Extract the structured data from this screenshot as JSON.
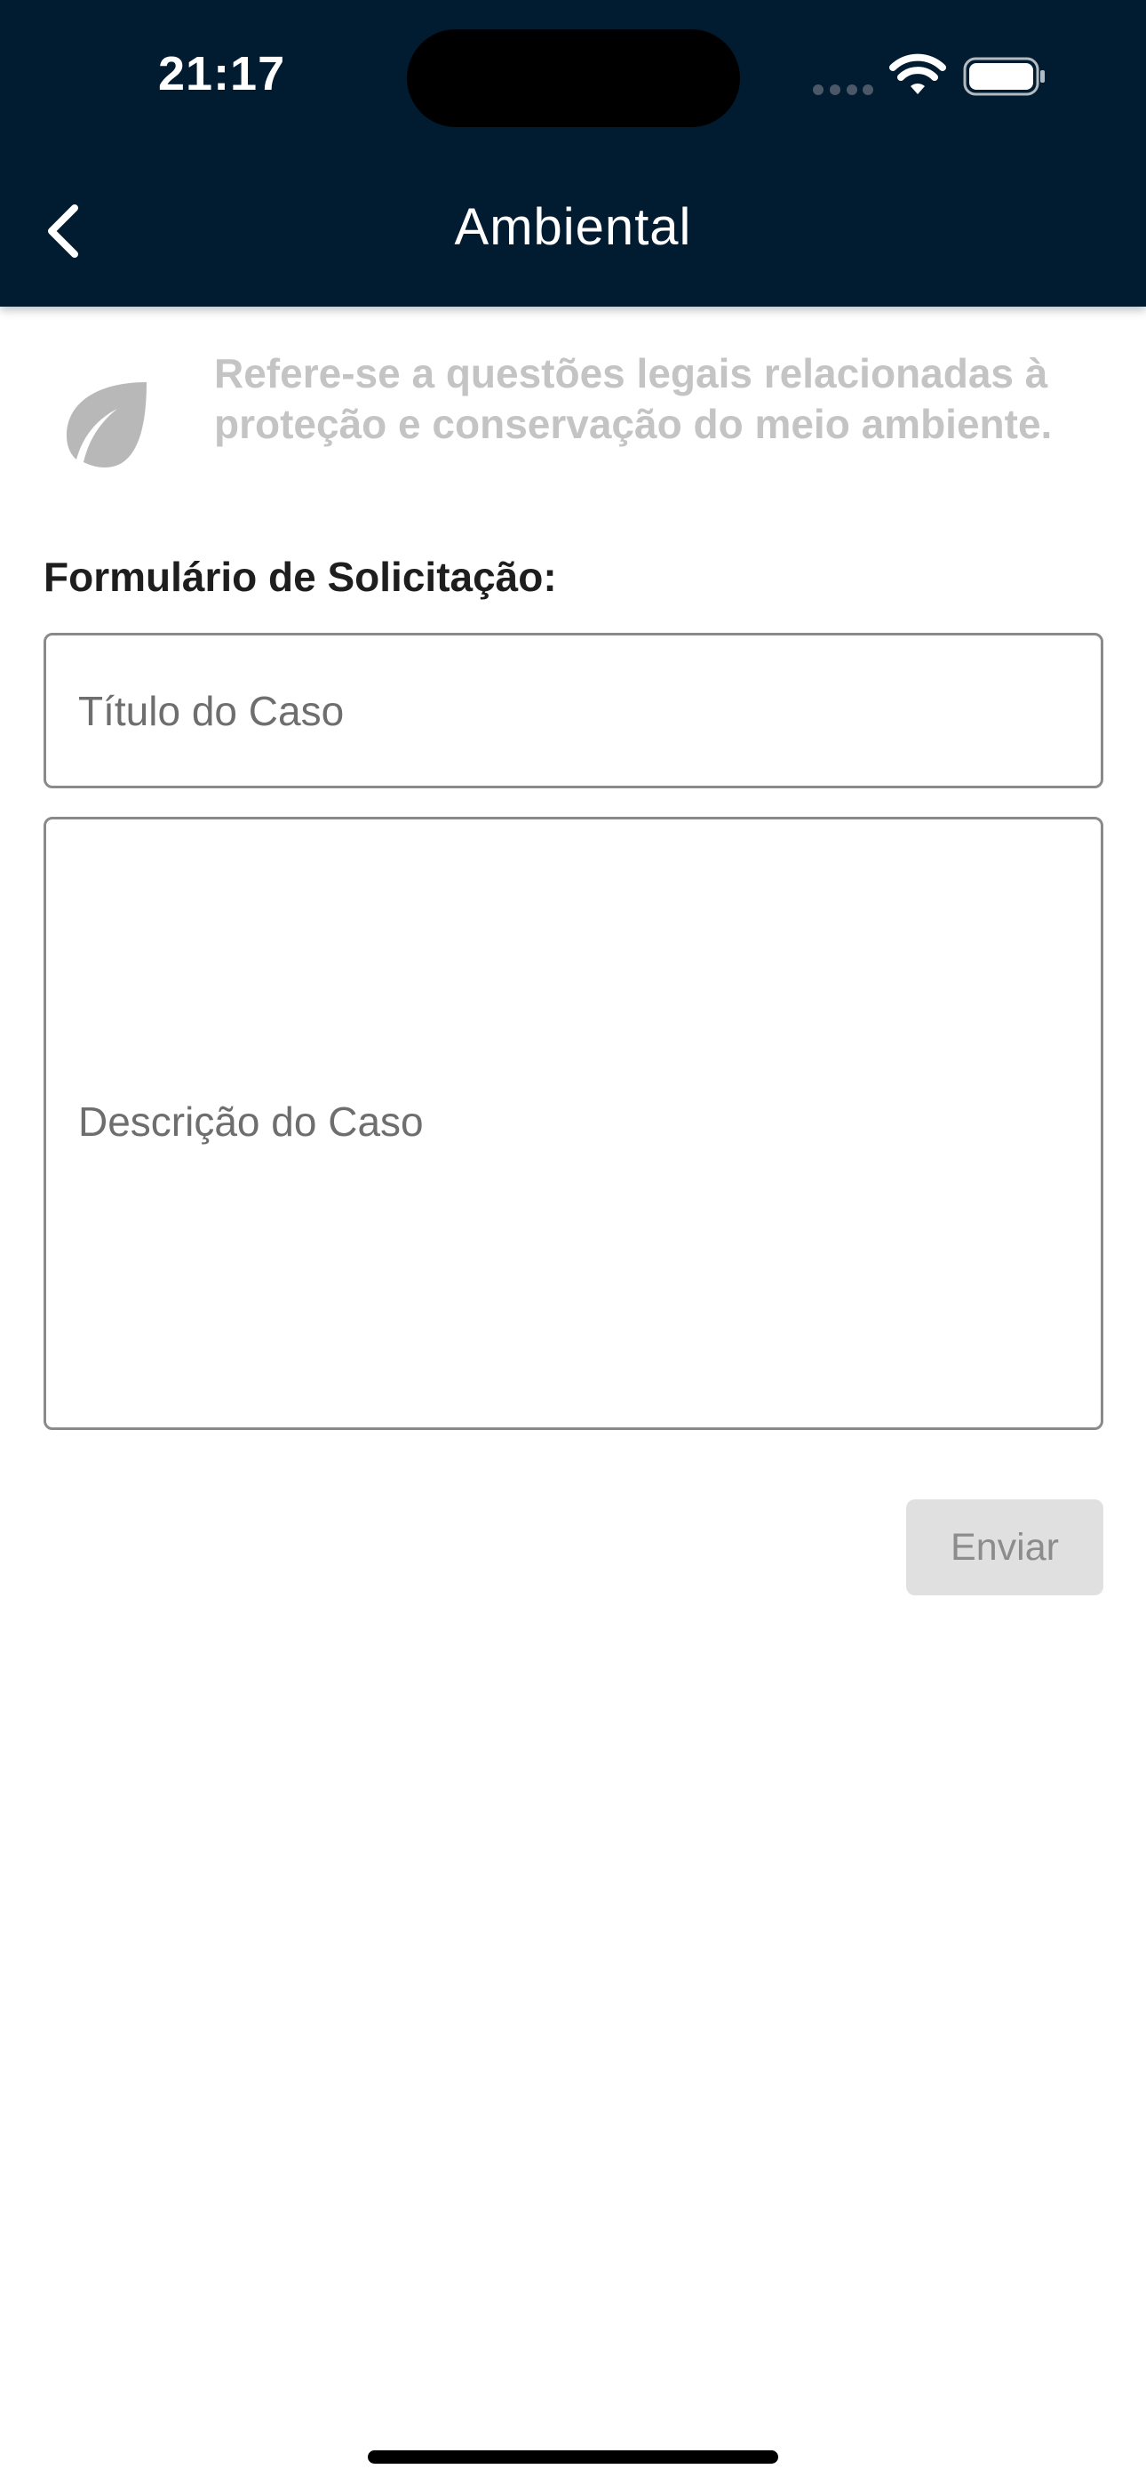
{
  "status_bar": {
    "time": "21:17",
    "icons": [
      "signal-icon",
      "wifi-icon",
      "battery-icon"
    ]
  },
  "header": {
    "title": "Ambiental",
    "back_icon": "chevron-left-icon",
    "background": "#011b30"
  },
  "category": {
    "icon": "leaf-icon",
    "description": "Refere-se a questões legais relacionadas à proteção e conservação do meio ambiente."
  },
  "form": {
    "label": "Formulário de Solicitação:",
    "title_field": {
      "placeholder": "Título do Caso",
      "value": ""
    },
    "description_field": {
      "placeholder": "Descrição do Caso",
      "value": ""
    },
    "submit_label": "Enviar"
  },
  "colors": {
    "header_bg": "#011b30",
    "muted_text": "#c4c4c4",
    "button_disabled_bg": "#e0e0e0",
    "button_disabled_text": "#8c8c8c"
  }
}
